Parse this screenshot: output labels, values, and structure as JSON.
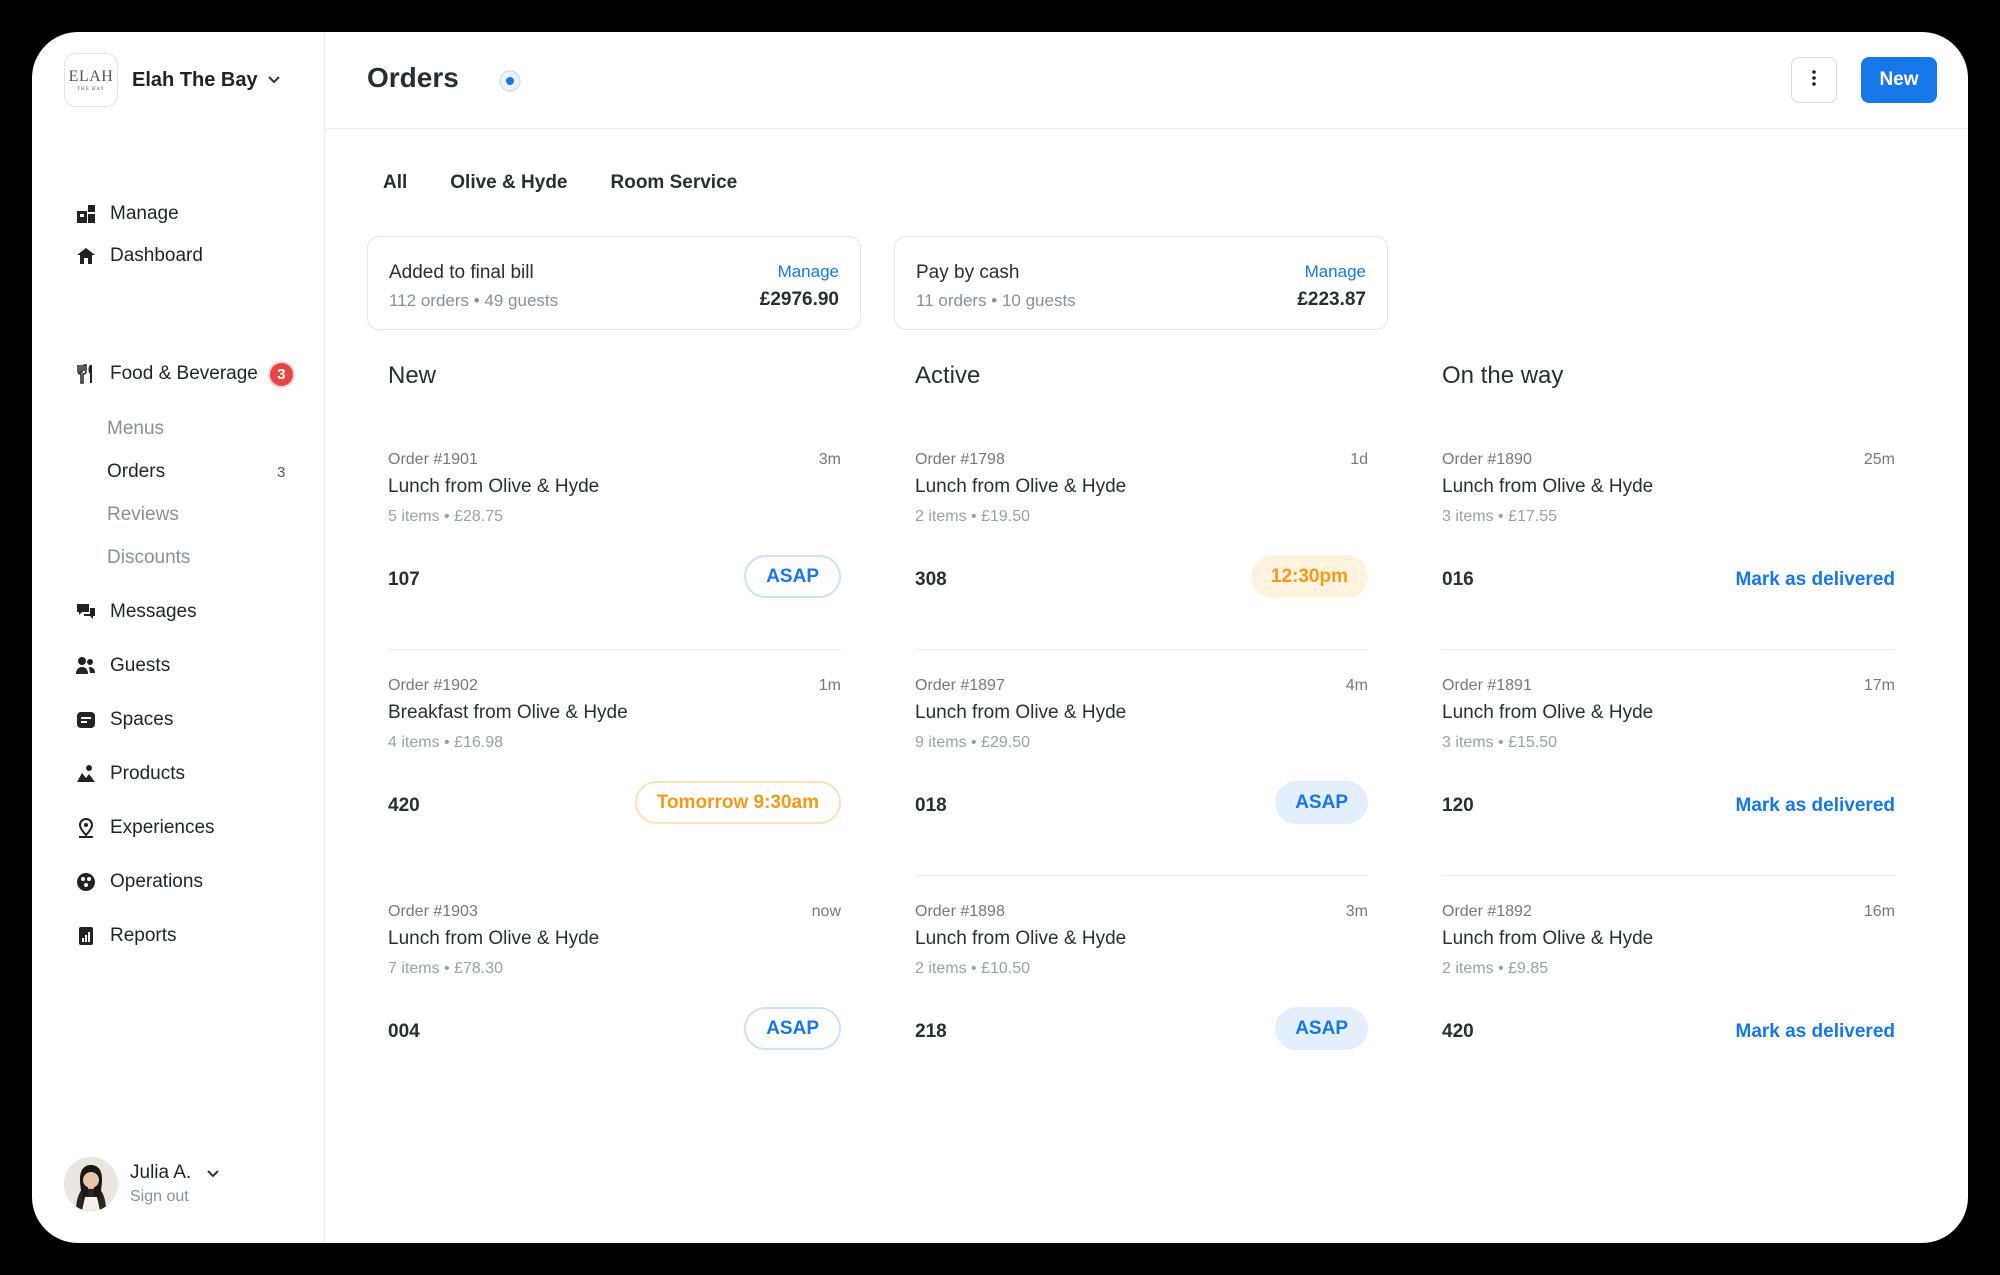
{
  "brand": {
    "logo_text": "ELAH",
    "logo_sub": "THE BAY",
    "name": "Elah The Bay"
  },
  "nav": {
    "manage": "Manage",
    "dashboard": "Dashboard",
    "food_beverage": "Food & Beverage",
    "food_badge": "3",
    "sub": {
      "menus": "Menus",
      "orders": "Orders",
      "orders_count": "3",
      "reviews": "Reviews",
      "discounts": "Discounts"
    },
    "messages": "Messages",
    "guests": "Guests",
    "spaces": "Spaces",
    "products": "Products",
    "experiences": "Experiences",
    "operations": "Operations",
    "reports": "Reports"
  },
  "user": {
    "name": "Julia A.",
    "sub": "Sign out"
  },
  "header": {
    "title": "Orders",
    "new_label": "New"
  },
  "tabs": [
    "All",
    "Olive & Hyde",
    "Room Service"
  ],
  "summaries": [
    {
      "title": "Added to final bill",
      "sub": "112 orders • 49 guests",
      "link": "Manage",
      "amount": "£2976.90"
    },
    {
      "title": "Pay by cash",
      "sub": "11 orders • 10 guests",
      "link": "Manage",
      "amount": "£223.87"
    }
  ],
  "columns": [
    {
      "title": "New",
      "orders": [
        {
          "num": "Order #1901",
          "time": "3m",
          "title": "Lunch from Olive & Hyde",
          "meta": "5 items • £28.75",
          "room": "107",
          "action": "ASAP"
        },
        {
          "num": "Order #1902",
          "time": "1m",
          "title": "Breakfast from Olive & Hyde",
          "meta": "4 items • £16.98",
          "room": "420",
          "action": "Tomorrow 9:30am"
        },
        {
          "num": "Order #1903",
          "time": "now",
          "title": "Lunch from Olive & Hyde",
          "meta": "7 items • £78.30",
          "room": "004",
          "action": "ASAP"
        }
      ]
    },
    {
      "title": "Active",
      "orders": [
        {
          "num": "Order #1798",
          "time": "1d",
          "title": "Lunch from Olive & Hyde",
          "meta": "2 items • £19.50",
          "room": "308",
          "action": "12:30pm"
        },
        {
          "num": "Order #1897",
          "time": "4m",
          "title": "Lunch from Olive & Hyde",
          "meta": "9 items • £29.50",
          "room": "018",
          "action": "ASAP"
        },
        {
          "num": "Order #1898",
          "time": "3m",
          "title": "Lunch from Olive & Hyde",
          "meta": "2 items • £10.50",
          "room": "218",
          "action": "ASAP"
        }
      ]
    },
    {
      "title": "On the way",
      "orders": [
        {
          "num": "Order #1890",
          "time": "25m",
          "title": "Lunch from Olive & Hyde",
          "meta": "3 items • £17.55",
          "room": "016",
          "action": "Mark as delivered"
        },
        {
          "num": "Order #1891",
          "time": "17m",
          "title": "Lunch from Olive & Hyde",
          "meta": "3 items • £15.50",
          "room": "120",
          "action": "Mark as delivered"
        },
        {
          "num": "Order #1892",
          "time": "16m",
          "title": "Lunch from Olive & Hyde",
          "meta": "2 items • £9.85",
          "room": "420",
          "action": "Mark as delivered"
        }
      ]
    }
  ],
  "colors": {
    "accent": "#1677e8",
    "warning": "#f39a19",
    "badge": "#e64545"
  }
}
